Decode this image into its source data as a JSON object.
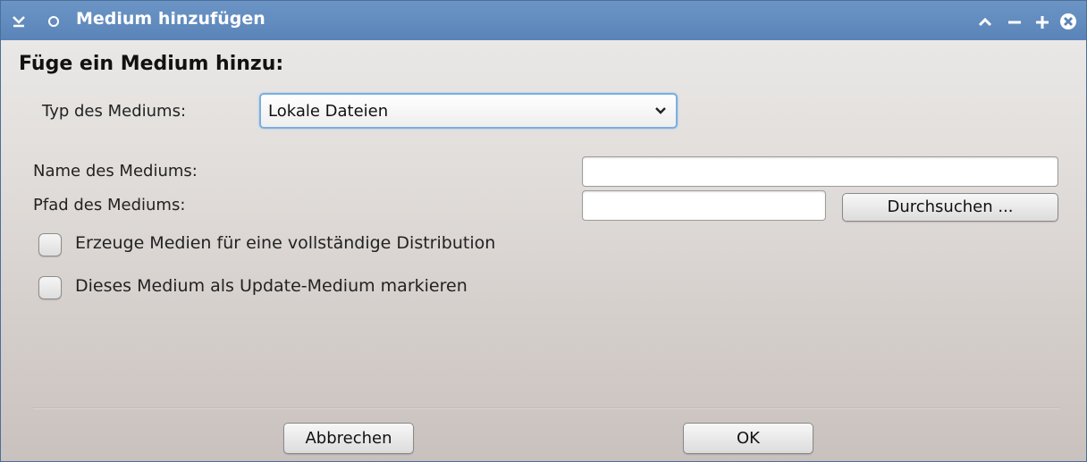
{
  "window": {
    "title": "Medium hinzufügen",
    "titlebar_color": "#5a84b8",
    "icons": [
      "window-menu-icon",
      "pin-icon",
      "keep-above-icon",
      "minimize-icon",
      "maximize-icon",
      "close-icon"
    ]
  },
  "form": {
    "heading": "Füge ein Medium hinzu:",
    "type_label": "Typ des Mediums:",
    "type_value": "Lokale Dateien",
    "name_label": "Name des Mediums:",
    "name_value": "",
    "path_label": "Pfad des Mediums:",
    "path_value": "",
    "browse_label": "Durchsuchen ...",
    "checkbox_full_distribution": "Erzeuge Medien für eine vollständige Distribution",
    "checkbox_full_distribution_checked": false,
    "checkbox_update_medium": "Dieses Medium als Update-Medium markieren",
    "checkbox_update_medium_checked": false
  },
  "footer": {
    "cancel_label": "Abbrechen",
    "ok_label": "OK"
  },
  "colors": {
    "focus_border": "#7aaee0"
  }
}
